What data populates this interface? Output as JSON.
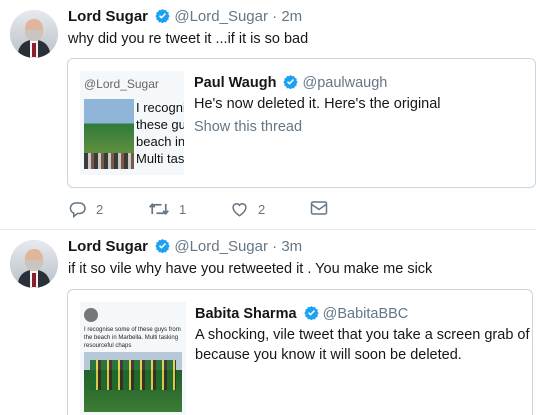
{
  "tweets": [
    {
      "name": "Lord Sugar",
      "handle": "@Lord_Sugar",
      "time": "· 2m",
      "text": "why did you re tweet it ...if it is so bad",
      "quote": {
        "thumb_handle": "@Lord_Sugar",
        "thumb_lines": [
          "I recogni",
          "these gu",
          "beach in",
          "Multi tas"
        ],
        "name": "Paul Waugh",
        "handle": "@paulwaugh",
        "text": "He's now deleted it. Here's the original",
        "link": "Show this thread"
      },
      "actions": {
        "replies": "2",
        "retweets": "1",
        "likes": "2"
      }
    },
    {
      "name": "Lord Sugar",
      "handle": "@Lord_Sugar",
      "time": "· 3m",
      "text": "if it so vile why have you retweeted it .  You make me sick",
      "quote": {
        "thumb_text": "I recognise some of these guys from the beach in Marbella. Multi tasking resourceful chaps",
        "name": "Babita Sharma",
        "handle": "@BabitaBBC",
        "text_line1": "A shocking, vile tweet that you take a screen grab of",
        "text_line2": "because you know it will soon be deleted."
      }
    }
  ],
  "colors": {
    "verified": "#1da1f2",
    "muted": "#657786",
    "border": "#ccd6dd"
  },
  "icons": [
    "verified-icon",
    "reply-icon",
    "retweet-icon",
    "like-icon",
    "dm-icon"
  ]
}
